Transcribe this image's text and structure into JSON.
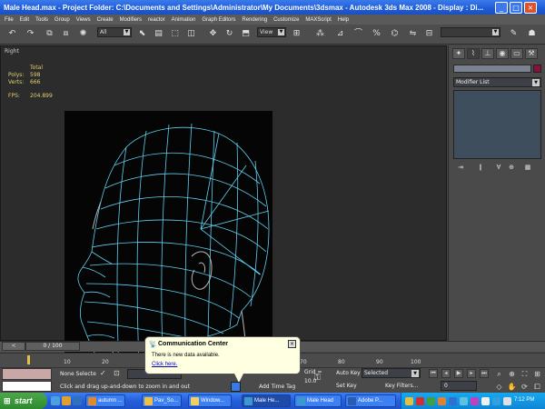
{
  "window": {
    "title": "Male Head.max    - Project Folder: C:\\Documents and Settings\\Administrator\\My Documents\\3dsmax    - Autodesk 3ds Max 2008      - Display : Di...",
    "min": "_",
    "max": "□",
    "close": "×"
  },
  "menu": [
    "File",
    "Edit",
    "Tools",
    "Group",
    "Views",
    "Create",
    "Modifiers",
    "reactor",
    "Animation",
    "Graph Editors",
    "Rendering",
    "Customize",
    "MAXScript",
    "Help"
  ],
  "toolbar": {
    "selection_filter": "All",
    "ref_coord": "View"
  },
  "viewport": {
    "label": "Right",
    "stats": {
      "total_label": "Total",
      "polys_label": "Polys:",
      "polys_value": "598",
      "verts_label": "Verts:",
      "verts_value": "666",
      "fps_label": "FPS:",
      "fps_value": "204.899"
    },
    "wire_color": "#5fd0f0"
  },
  "command_panel": {
    "modifier_list": "Modifier List",
    "object_color": "#8a1040"
  },
  "timeline": {
    "frame_counter": "0 / 100",
    "ticks": [
      "10",
      "20",
      "70",
      "80",
      "90",
      "100"
    ]
  },
  "status": {
    "selection_info": "None Selecte",
    "prompt": "Click and drag up-and-down to zoom in and out",
    "add_time_tag": "Add Time Tag",
    "grid": "Grid = 10.0",
    "auto_key": "Auto Key",
    "set_key": "Set Key",
    "selected": "Selected",
    "key_filters": "Key Filters...",
    "frame": "0"
  },
  "balloon": {
    "title": "Communication Center",
    "message": "There is new data available.",
    "link": "Click here."
  },
  "taskbar": {
    "start": "start",
    "tasks": [
      {
        "label": "autumn ...",
        "color": "#e08a2c"
      },
      {
        "label": "Pav_So...",
        "color": "#f0c040"
      },
      {
        "label": "Window...",
        "color": "#f0d060"
      },
      {
        "label": "Male He...",
        "color": "#3a9ad0",
        "active": true
      },
      {
        "label": "Male Head",
        "color": "#3a9ad0"
      },
      {
        "label": "Adobe P...",
        "color": "#2a5db0"
      }
    ],
    "clock": "7:12 PM"
  }
}
